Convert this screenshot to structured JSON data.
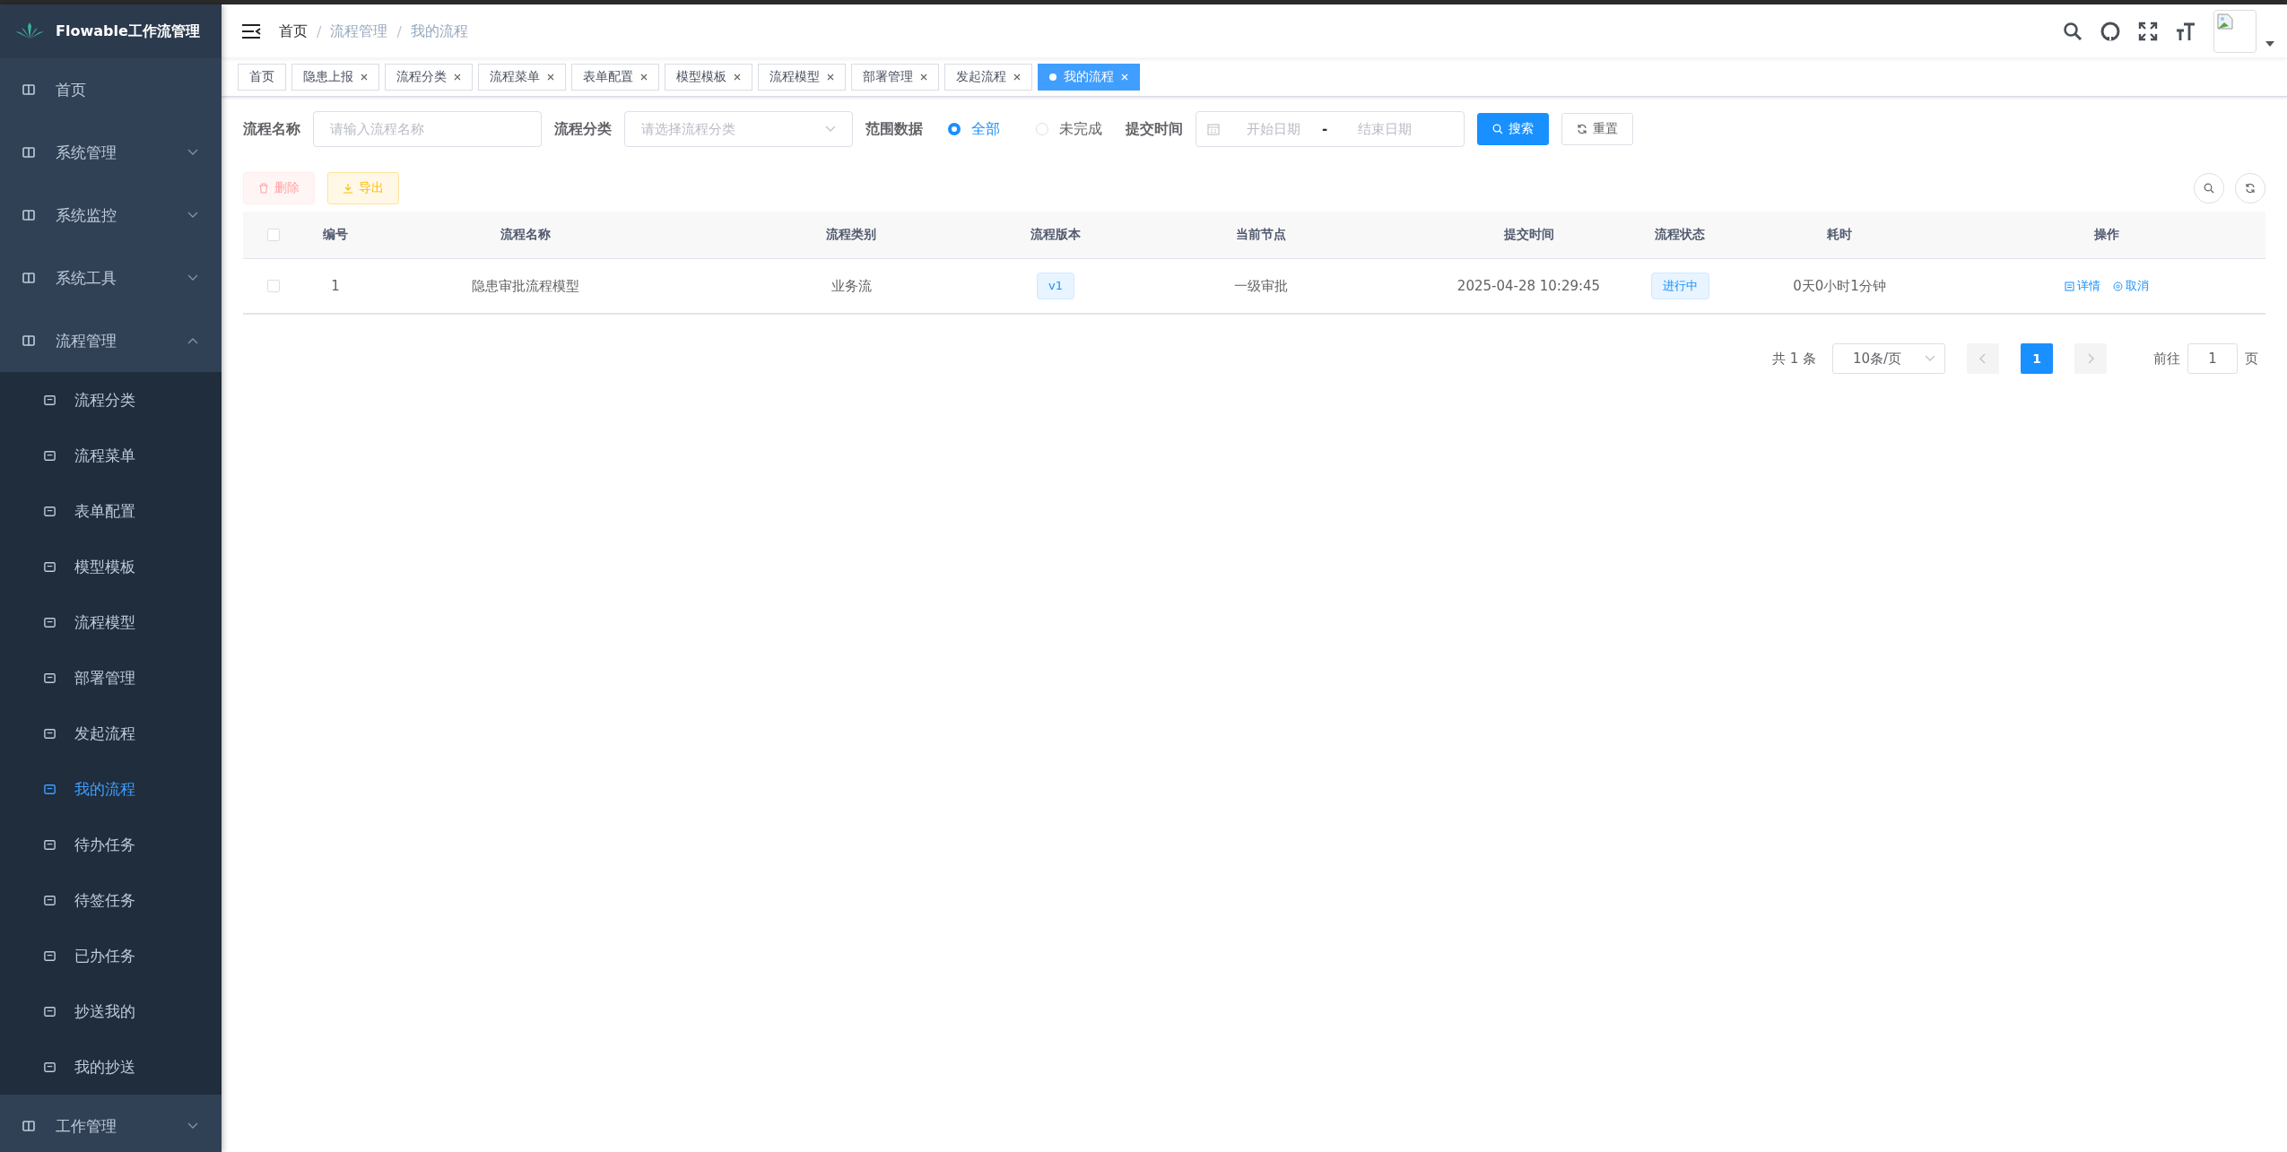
{
  "sidebar": {
    "logo_title": "Flowable工作流管理",
    "items": [
      {
        "label": "首页",
        "kind": "link"
      },
      {
        "label": "系统管理",
        "kind": "submenu",
        "expanded": false
      },
      {
        "label": "系统监控",
        "kind": "submenu",
        "expanded": false
      },
      {
        "label": "系统工具",
        "kind": "submenu",
        "expanded": false
      },
      {
        "label": "流程管理",
        "kind": "submenu",
        "expanded": true,
        "children": [
          {
            "label": "流程分类",
            "selected": false
          },
          {
            "label": "流程菜单",
            "selected": false
          },
          {
            "label": "表单配置",
            "selected": false
          },
          {
            "label": "模型模板",
            "selected": false
          },
          {
            "label": "流程模型",
            "selected": false
          },
          {
            "label": "部署管理",
            "selected": false
          },
          {
            "label": "发起流程",
            "selected": false
          },
          {
            "label": "我的流程",
            "selected": true
          },
          {
            "label": "待办任务",
            "selected": false
          },
          {
            "label": "待签任务",
            "selected": false
          },
          {
            "label": "已办任务",
            "selected": false
          },
          {
            "label": "抄送我的",
            "selected": false
          },
          {
            "label": "我的抄送",
            "selected": false
          }
        ]
      },
      {
        "label": "工作管理",
        "kind": "submenu",
        "expanded": false
      }
    ]
  },
  "breadcrumb": [
    {
      "label": "首页"
    },
    {
      "separator": "/",
      "label": "流程管理"
    },
    {
      "separator": "/",
      "label": "我的流程"
    }
  ],
  "tags": [
    {
      "label": "首页",
      "selected": false,
      "closable": false
    },
    {
      "label": "隐患上报",
      "selected": false,
      "closable": true
    },
    {
      "label": "流程分类",
      "selected": false,
      "closable": true
    },
    {
      "label": "流程菜单",
      "selected": false,
      "closable": true
    },
    {
      "label": "表单配置",
      "selected": false,
      "closable": true
    },
    {
      "label": "模型模板",
      "selected": false,
      "closable": true
    },
    {
      "label": "流程模型",
      "selected": false,
      "closable": true
    },
    {
      "label": "部署管理",
      "selected": false,
      "closable": true
    },
    {
      "label": "发起流程",
      "selected": false,
      "closable": true
    },
    {
      "label": "我的流程",
      "selected": true,
      "closable": true
    }
  ],
  "search_form": {
    "name": {
      "label": "流程名称",
      "placeholder": "请输入流程名称"
    },
    "category": {
      "label": "流程分类",
      "placeholder": "请选择流程分类"
    },
    "scope": {
      "label": "范围数据",
      "options": [
        {
          "label": "全部",
          "selected": true
        },
        {
          "label": "未完成",
          "selected": false
        }
      ]
    },
    "submit_time": {
      "label": "提交时间",
      "start_placeholder": "开始日期",
      "separator": "-",
      "end_placeholder": "结束日期"
    },
    "buttons": [
      {
        "label": "搜索",
        "kind": "primary"
      },
      {
        "label": "重置",
        "kind": "default"
      }
    ]
  },
  "toolbar": [
    {
      "label": "删除",
      "kind": "danger",
      "disabled": true
    },
    {
      "label": "导出",
      "kind": "warning",
      "disabled": false
    }
  ],
  "table": {
    "select_all_checked": false,
    "columns": [
      "编号",
      "流程名称",
      "流程类别",
      "流程版本",
      "当前节点",
      "提交时间",
      "流程状态",
      "耗时",
      "操作"
    ],
    "rows": [
      {
        "checked": false,
        "id": "1",
        "name": "隐患审批流程模型",
        "category": "业务流",
        "version": "v1",
        "node": "一级审批",
        "submit_time": "2025-04-28 10:29:45",
        "status": "进行中",
        "duration": "0天0小时1分钟",
        "actions": [
          "详情",
          "取消"
        ]
      }
    ]
  },
  "pagination": {
    "total": "共 1 条",
    "page_size": "10条/页",
    "pages": [
      {
        "label": "1",
        "selected": true
      }
    ],
    "goto_label": "前往",
    "goto_value": "1",
    "goto_suffix": "页"
  }
}
